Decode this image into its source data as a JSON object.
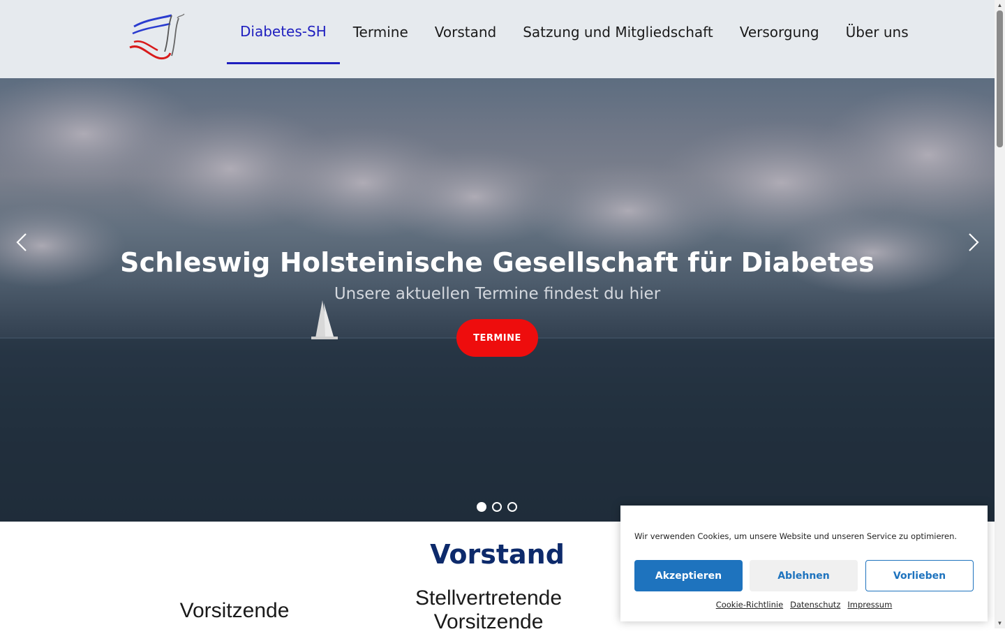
{
  "nav": {
    "items": [
      {
        "label": "Diabetes-SH",
        "active": true
      },
      {
        "label": "Termine",
        "active": false
      },
      {
        "label": "Vorstand",
        "active": false
      },
      {
        "label": "Satzung und Mitgliedschaft",
        "active": false
      },
      {
        "label": "Versorgung",
        "active": false
      },
      {
        "label": "Über uns",
        "active": false
      }
    ]
  },
  "hero": {
    "title": "Schleswig Holsteinische Gesellschaft für Diabetes",
    "subtitle": "Unsere aktuellen Termine findest du hier",
    "button_label": "TERMINE",
    "slides": 3,
    "active_slide": 1,
    "prev_icon": "chevron-left-icon",
    "next_icon": "chevron-right-icon"
  },
  "content": {
    "section_title": "Vorstand",
    "col1_label": "Vorsitzende",
    "col2_label": "Stellvertretende Vorsitzende"
  },
  "cookie": {
    "text": "Wir verwenden Cookies, um unsere Website und unseren Service zu optimieren.",
    "accept_label": "Akzeptieren",
    "deny_label": "Ablehnen",
    "prefs_label": "Vorlieben",
    "links": [
      "Cookie-Richtlinie",
      "Datenschutz",
      "Impressum"
    ]
  },
  "colors": {
    "nav_active": "#1f1fbf",
    "hero_button": "#ee0d0d",
    "section_title": "#0d2a6b",
    "cookie_accent": "#1e73be"
  }
}
